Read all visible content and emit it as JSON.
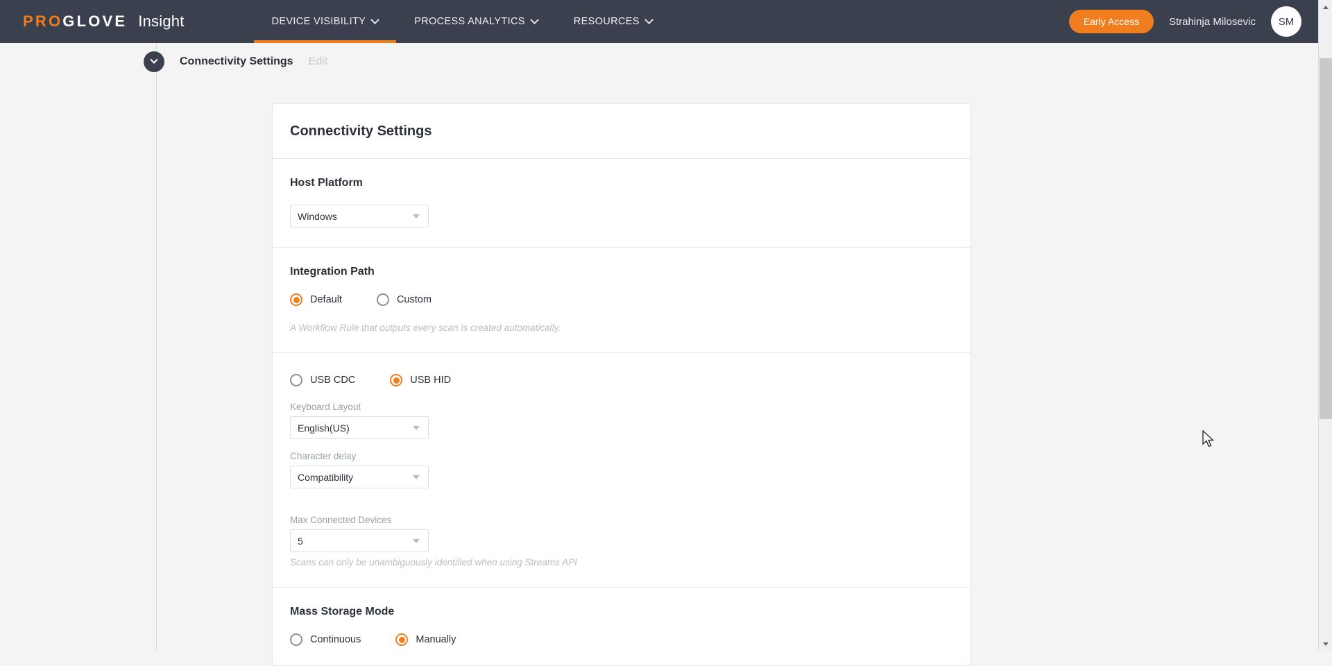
{
  "header": {
    "brand": {
      "pro": "PRO",
      "glove": "GLOVE",
      "product": "Insight"
    },
    "nav": [
      {
        "label": "DEVICE VISIBILITY",
        "icon": "chevron-down-icon",
        "active": true
      },
      {
        "label": "PROCESS ANALYTICS",
        "icon": "chevron-down-icon",
        "active": false
      },
      {
        "label": "RESOURCES",
        "icon": "chevron-down-icon",
        "active": false
      }
    ],
    "early_access_label": "Early Access",
    "user_name": "Strahinja Milosevic",
    "avatar_initials": "SM",
    "bar_color": "#3a404e",
    "accent_color": "#f07d1e"
  },
  "breadcrumb": {
    "collapse_icon": "chevron-down-icon",
    "title": "Connectivity Settings",
    "edit_label": "Edit"
  },
  "card": {
    "title": "Connectivity Settings",
    "sections": {
      "host_platform": {
        "title": "Host Platform",
        "select_value": "Windows"
      },
      "integration_path": {
        "title": "Integration Path",
        "options": [
          {
            "label": "Default",
            "checked": true
          },
          {
            "label": "Custom",
            "checked": false
          }
        ],
        "hint": "A Workflow Rule that outputs every scan is created automatically."
      },
      "usb_mode": {
        "options": [
          {
            "label": "USB CDC",
            "checked": false
          },
          {
            "label": "USB HID",
            "checked": true
          }
        ],
        "keyboard_layout_label": "Keyboard Layout",
        "keyboard_layout_value": "English(US)",
        "character_delay_label": "Character delay",
        "character_delay_value": "Compatibility",
        "max_devices_label": "Max Connected Devices",
        "max_devices_value": "5",
        "max_devices_hint": "Scans can only be unambiguously identified when using Streams API"
      },
      "mass_storage": {
        "title": "Mass Storage Mode",
        "options": [
          {
            "label": "Continuous",
            "checked": false
          },
          {
            "label": "Manually",
            "checked": true
          }
        ]
      }
    }
  },
  "scrollbar": {
    "up_icon": "arrow-up-icon",
    "down_icon": "arrow-down-icon"
  }
}
